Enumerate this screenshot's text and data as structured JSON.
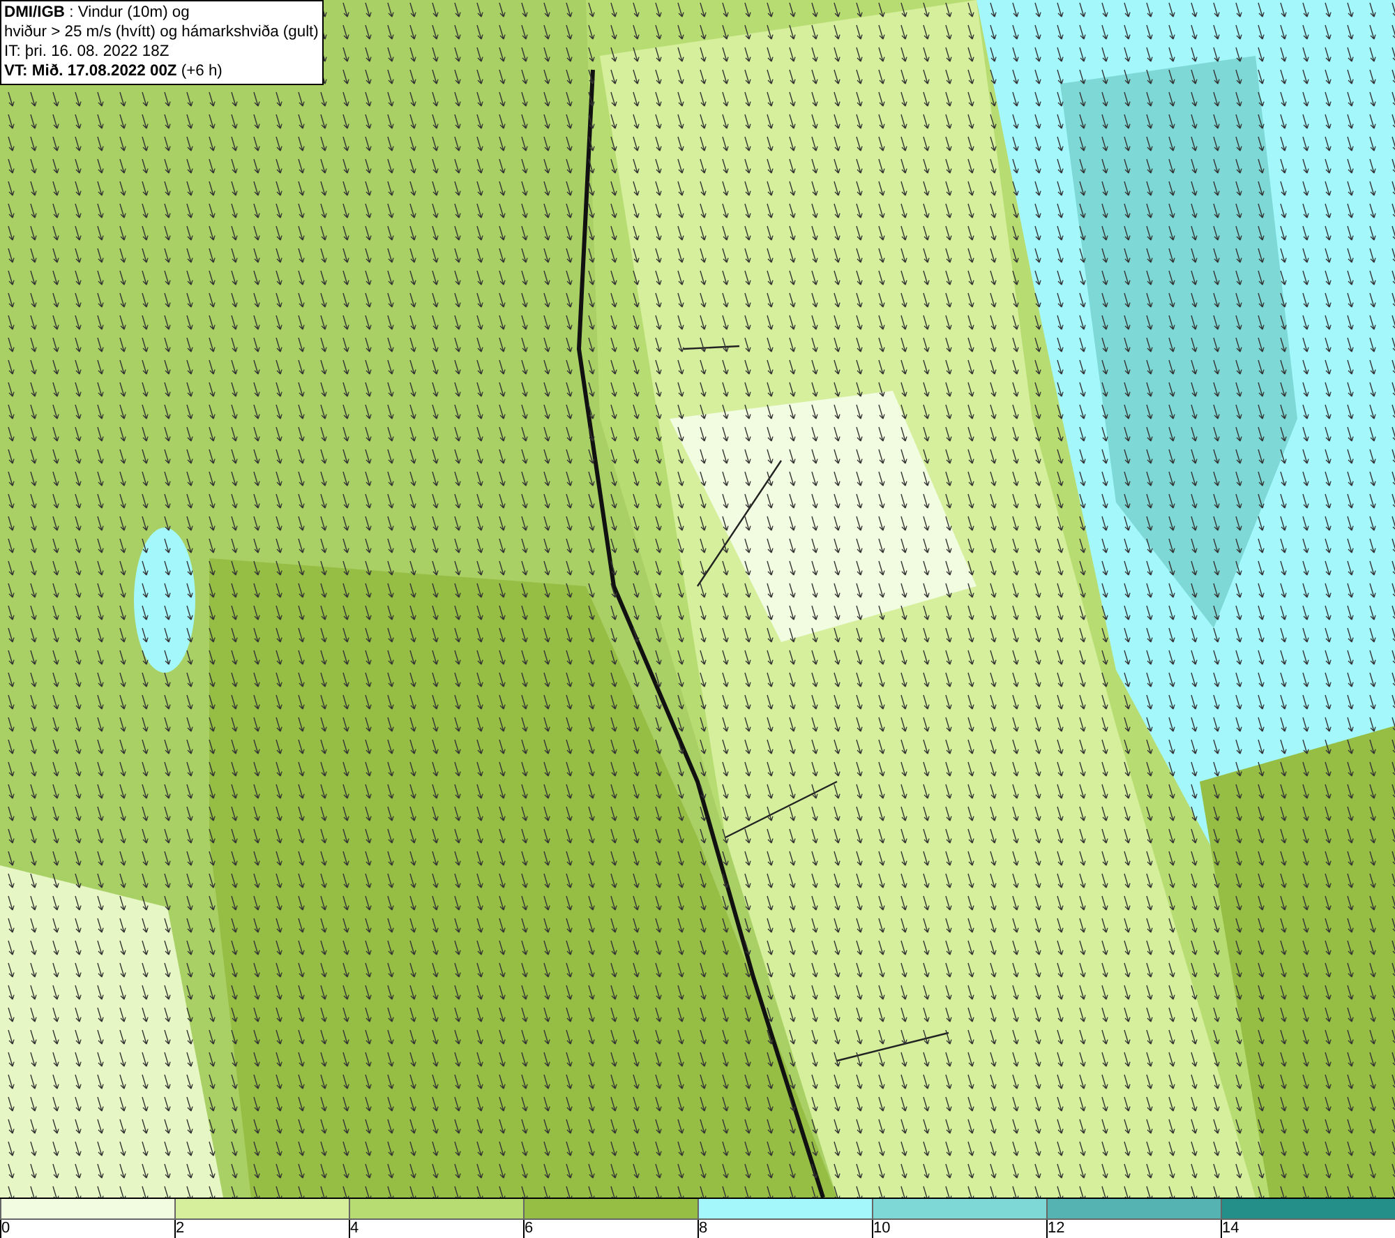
{
  "title_box": {
    "lines": [
      "**DMI/IGB** : Vindur (10m) og",
      "hviður > 25 m/s (hvítt) og hámarkshviða (gult)",
      "IT: þri. 16. 08. 2022 18Z",
      "**VT: Mið. 17.08.2022 00Z** (+6 h)"
    ]
  },
  "legend": {
    "bins": [
      {
        "color": "#f2fce0"
      },
      {
        "color": "#d5ef9c"
      },
      {
        "color": "#b7dc72"
      },
      {
        "color": "#96be44"
      },
      {
        "color": "#a4f8fb"
      },
      {
        "color": "#7ed8d6"
      },
      {
        "color": "#55b4b2"
      },
      {
        "color": "#248f88"
      }
    ],
    "labels": [
      "0",
      "2",
      "4",
      "6",
      "8",
      "10",
      "12",
      "14"
    ]
  }
}
